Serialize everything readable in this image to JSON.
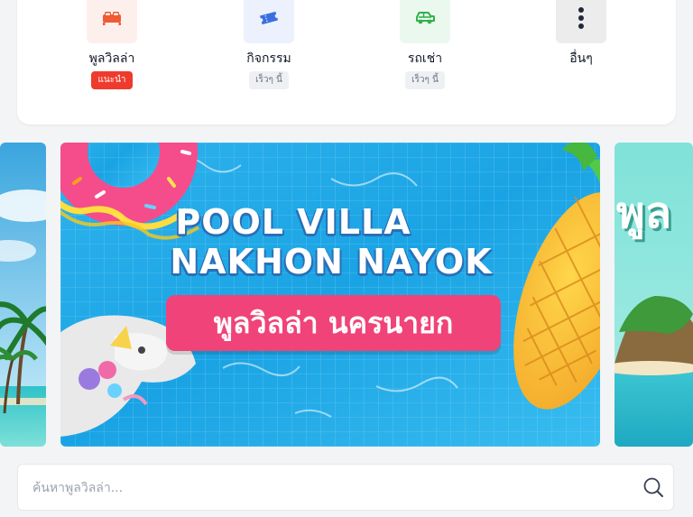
{
  "categories": [
    {
      "label": "พูลวิลล่า",
      "badge": "แนะนำ",
      "icon": "bed-icon",
      "color": "#ef5b34",
      "bg": "#fdf0ec"
    },
    {
      "label": "กิจกรรม",
      "badge": "เร็วๆ นี้",
      "icon": "ticket-icon",
      "color": "#3b6fe0",
      "bg": "#ecf1fd"
    },
    {
      "label": "รถเช่า",
      "badge": "เร็วๆ นี้",
      "icon": "car-icon",
      "color": "#2fb24c",
      "bg": "#ebf8ee"
    },
    {
      "label": "อื่นๆ",
      "icon": "more-vertical-icon",
      "color": "#1f2937",
      "bg": "#ececec"
    }
  ],
  "banner": {
    "title_line1": "POOL VILLA",
    "title_line2": "NAKHON NAYOK",
    "subtitle": "พูลวิลล่า นครนายก",
    "next_slide_text": "พูล"
  },
  "search": {
    "placeholder": "ค้นหาพูลวิลล่า..."
  }
}
